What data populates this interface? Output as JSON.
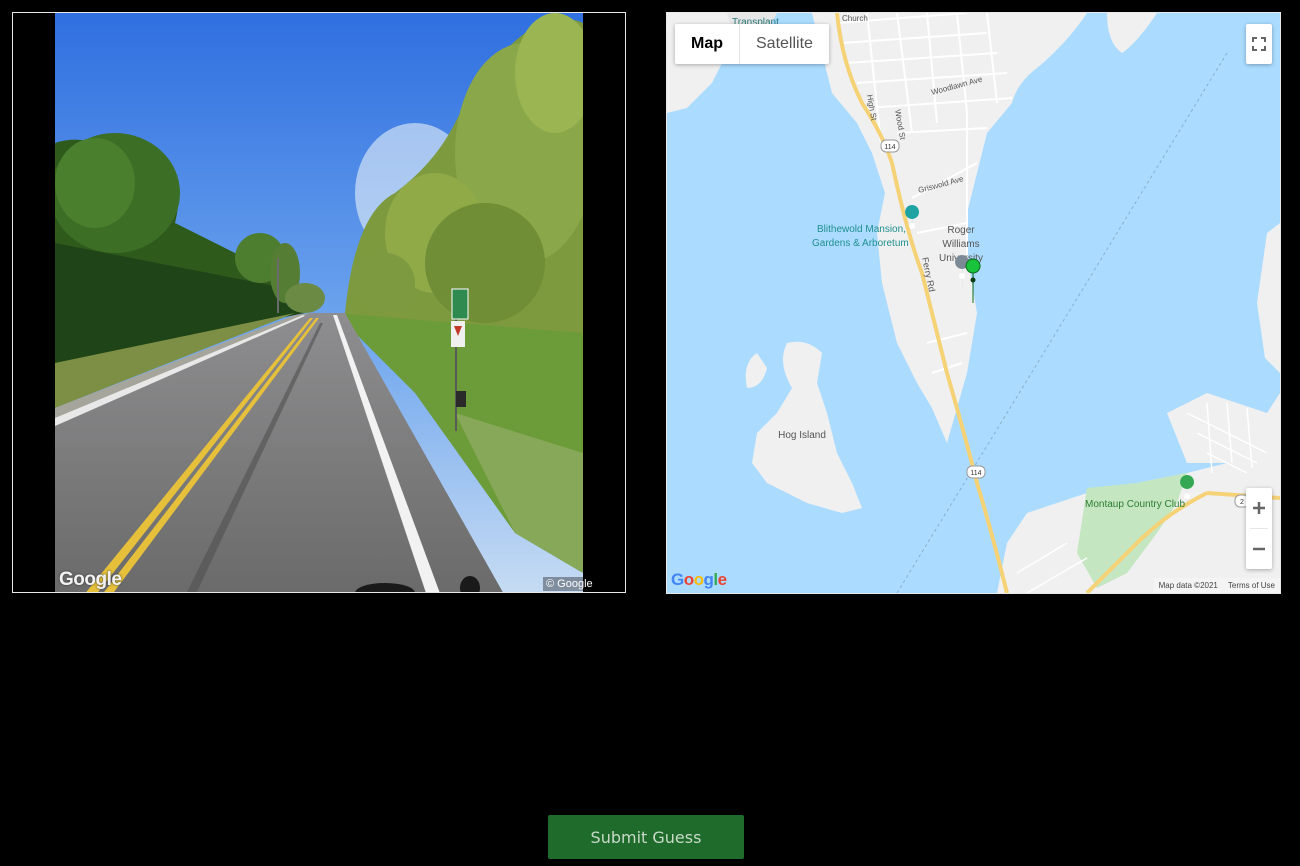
{
  "street_view": {
    "logo": "Google",
    "copyright": "© Google"
  },
  "map": {
    "type_control": {
      "map_label": "Map",
      "satellite_label": "Satellite",
      "selected": "Map"
    },
    "labels": {
      "transplant": "Transplant",
      "church": "Church",
      "woodlawn": "Woodlawn Ave",
      "high_st": "High St",
      "wood_st": "Wood St",
      "griswold": "Griswold Ave",
      "blithewold_1": "Blithewold Mansion,",
      "blithewold_2": "Gardens & Arboretum",
      "rwu_1": "Roger",
      "rwu_2": "Williams",
      "rwu_3": "University",
      "ferry_rd": "Ferry Rd",
      "hog_island": "Hog Island",
      "montaup": "Montaup Country Club",
      "route_114": "114",
      "route_2": "2"
    },
    "logo": "Google",
    "attribution": "Map data ©2021",
    "terms": "Terms of Use",
    "colors": {
      "water": "#abdcff",
      "land": "#f0f0f0",
      "park": "#c4e6c0",
      "highway": "#f6d277",
      "poi_green": "#34a853",
      "marker": "#18c23a"
    }
  },
  "submit": {
    "label": "Submit Guess"
  }
}
